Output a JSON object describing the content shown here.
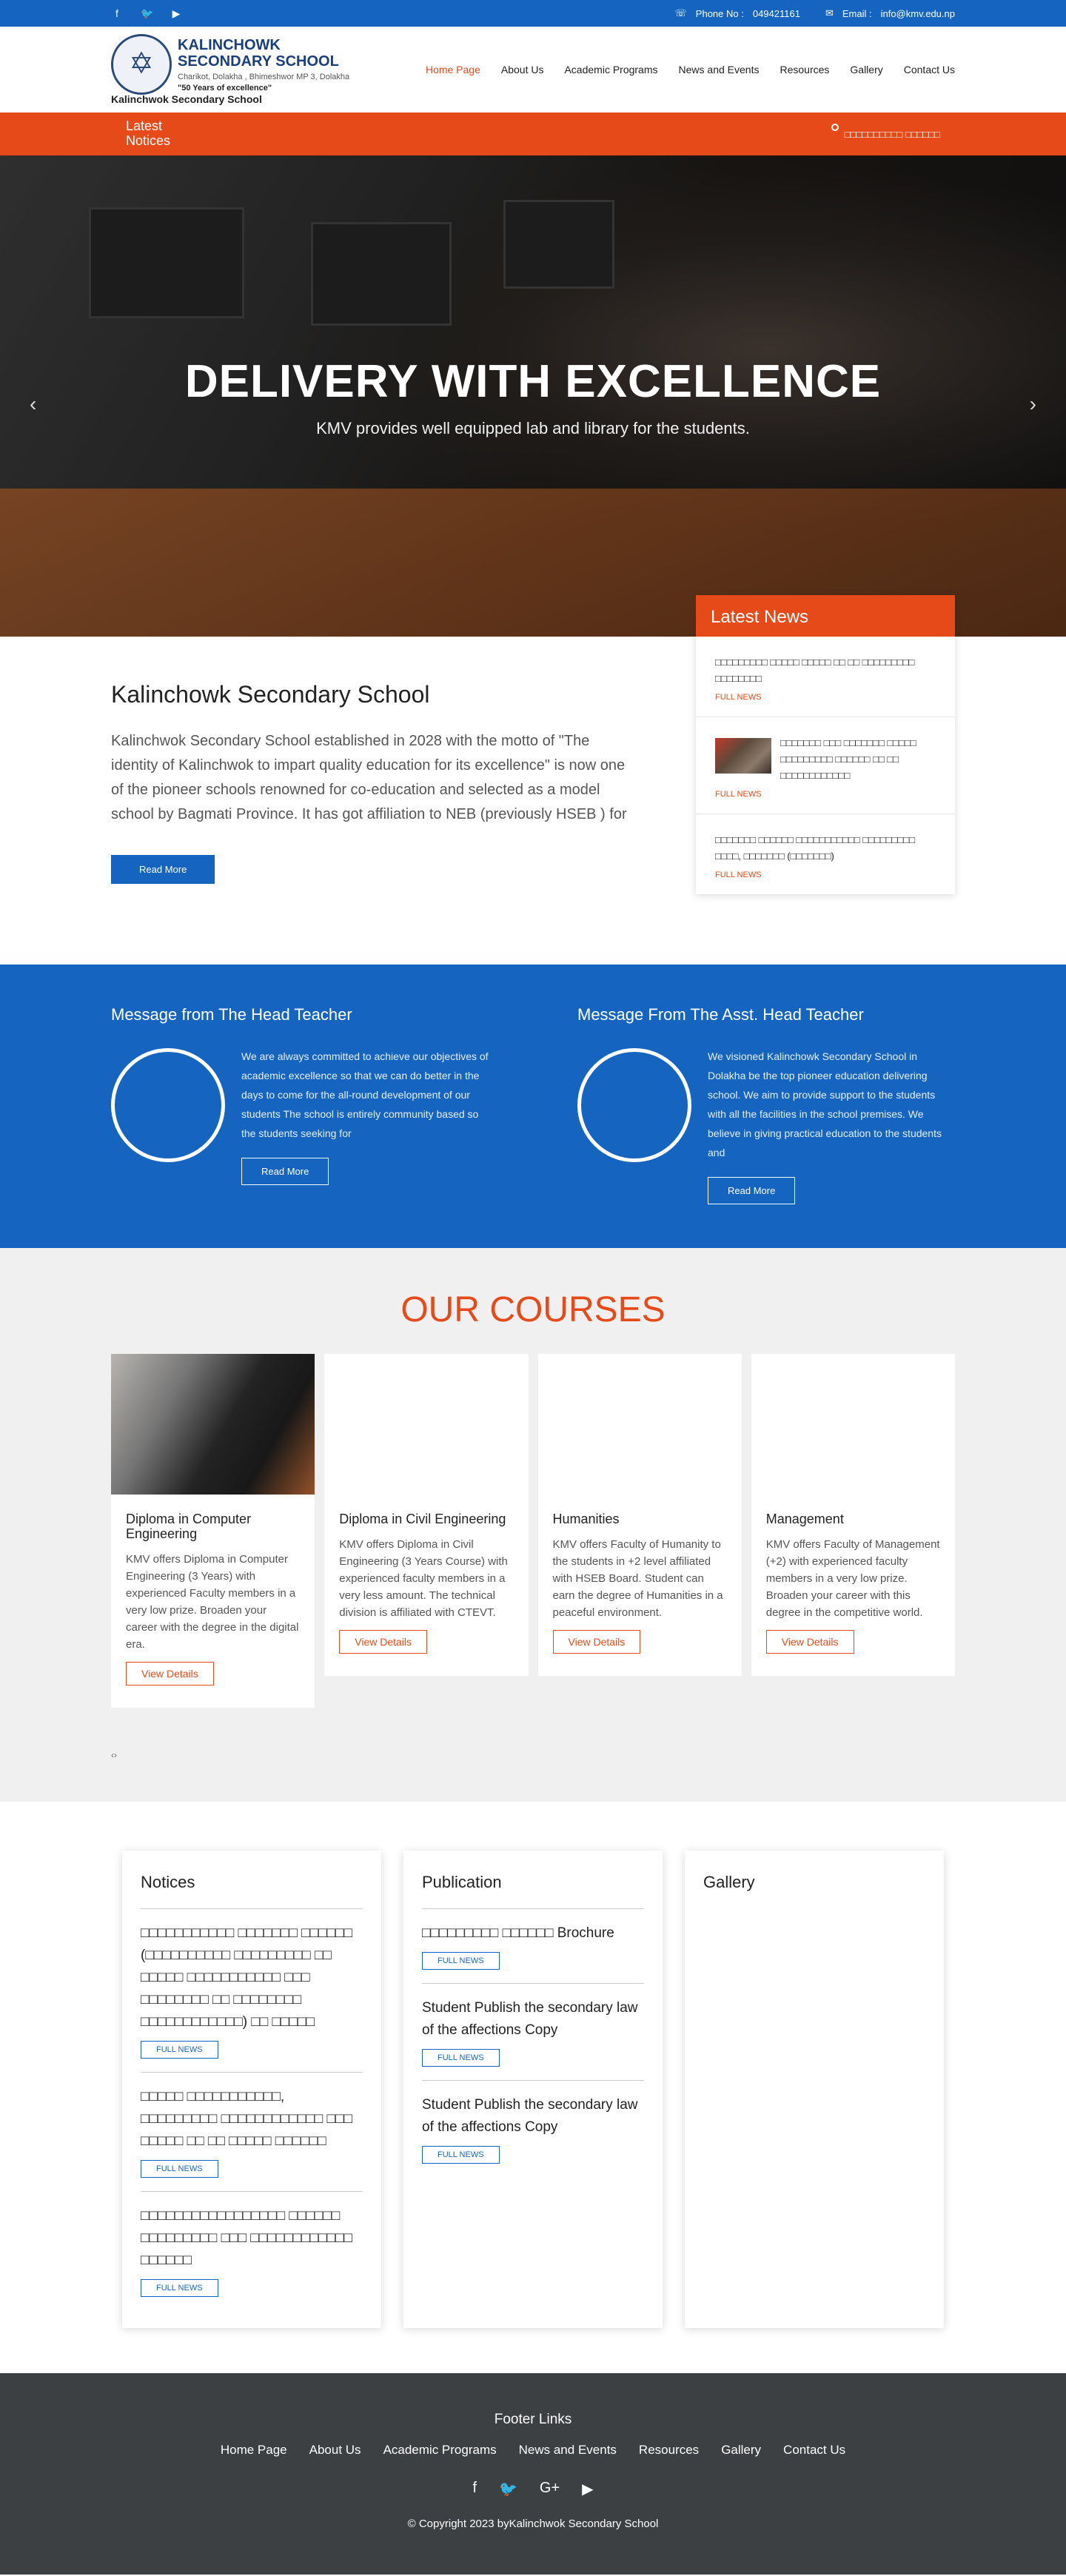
{
  "topbar": {
    "social": [
      {
        "icon": "facebook-icon",
        "glyph": "f"
      },
      {
        "icon": "twitter-icon",
        "glyph": "🐦"
      },
      {
        "icon": "youtube-icon",
        "glyph": "▶"
      }
    ],
    "phone_label": "Phone No :",
    "phone": "049421161",
    "email_label": "Email :",
    "email": "info@kmv.edu.np"
  },
  "brand": {
    "name": "KALINCHOWK SECONDARY SCHOOL",
    "address": "Charikot, Dolakha , Bhimeshwor MP 3, Dolakha",
    "motto": "\"50 Years of excellence\"",
    "subtitle": "Kalinchwok Secondary School"
  },
  "nav": [
    "Home Page",
    "About Us",
    "Academic Programs",
    "News and Events",
    "Resources",
    "Gallery",
    "Contact Us"
  ],
  "notice_strip": {
    "label": "Latest Notices",
    "ticker": "□□□□□□□□□□ □□□□□□"
  },
  "hero": {
    "title": "DELIVERY WITH EXCELLENCE",
    "subtitle": "KMV provides well equipped lab and library for the students.",
    "prev": "‹",
    "next": "›"
  },
  "intro": {
    "title": "Kalinchowk Secondary School",
    "body": "Kalinchwok Secondary School established in 2028 with the motto of \"The identity of Kalinchwok to impart quality education for its excellence\" is now one of the pioneer schools renowned for co-education and selected as a model school by Bagmati Province. It has got affiliation to NEB (previously HSEB ) for",
    "button": "Read More"
  },
  "latest_news": {
    "title": "Latest News",
    "full_news": "FULL NEWS",
    "items": [
      {
        "text": "□□□□□□□□□ □□□□□ □□□□□ □□ □□ □□□□□□□□□ □□□□□□□□"
      },
      {
        "text": "□□□□□□□ □□□ □□□□□□□ □□□□□ □□□□□□□□□ □□□□□□ □□ □□ □□□□□□□□□□□□"
      },
      {
        "text": "□□□□□□□ □□□□□□ □□□□□□□□□□□ □□□□□□□□□ □□□□, □□□□□□□ (□□□□□□□)"
      }
    ]
  },
  "messages": [
    {
      "title": "Message from The Head Teacher",
      "text": "We are always committed to achieve our objectives of academic excellence so that we can do better in the days to come  for the all-round development  of our students The school is entirely community based so the students  seeking for",
      "button": "Read More"
    },
    {
      "title": "Message From The Asst. Head Teacher",
      "text": "We visioned Kalinchowk Secondary School in Dolakha be the top pioneer education delivering school. We aim to provide support to the students with all the facilities in the school premises. We believe in giving practical education to the students and",
      "button": "Read More"
    }
  ],
  "courses": {
    "title": "OUR COURSES",
    "button": "View Details",
    "dots": "‹›",
    "items": [
      {
        "title": "Diploma in Computer Engineering",
        "desc": "KMV offers Diploma in Computer Engineering (3 Years) with experienced Faculty members in a very low prize. Broaden your career with the degree in the digital era."
      },
      {
        "title": "Diploma in Civil Engineering",
        "desc": "KMV offers Diploma in Civil Engineering (3 Years Course) with experienced faculty members in a very less amount. The technical division is affiliated with CTEVT."
      },
      {
        "title": "Humanities",
        "desc": "KMV offers Faculty of Humanity to the students in +2 level affiliated with HSEB Board. Student can earn the degree of Humanities in a peaceful environment."
      },
      {
        "title": "Management",
        "desc": "KMV offers Faculty of Management (+2) with experienced faculty members in a very low prize. Broaden your career with this degree in the competitive world."
      }
    ]
  },
  "notices": {
    "title": "Notices",
    "button": "FULL NEWS",
    "items": [
      {
        "text": "□□□□□□□□□□□ □□□□□□□ □□□□□□ (□□□□□□□□□□ □□□□□□□□□ □□ □□□□□ □□□□□□□□□□□ □□□ □□□□□□□□ □□ □□□□□□□□ □□□□□□□□□□□□) □□ □□□□□"
      },
      {
        "text": "□□□□□ □□□□□□□□□□□, □□□□□□□□□ □□□□□□□□□□□□ □□□ □□□□□ □□ □□ □□□□□ □□□□□□"
      },
      {
        "text": "□□□□□□□□□□□□□□□□□ □□□□□□ □□□□□□□□□ □□□ □□□□□□□□□□□□ □□□□□□"
      }
    ]
  },
  "publication": {
    "title": "Publication",
    "button": "FULL NEWS",
    "items": [
      {
        "text": "□□□□□□□□□ □□□□□□ Brochure"
      },
      {
        "text": "Student Publish the secondary law of the affections Copy"
      },
      {
        "text": "Student Publish the secondary law of the affections Copy"
      }
    ]
  },
  "gallery": {
    "title": "Gallery"
  },
  "footer": {
    "title": "Footer Links",
    "links": [
      "Home Page",
      "About Us",
      "Academic Programs",
      "News and Events",
      "Resources",
      "Gallery",
      "Contact Us"
    ],
    "social": [
      {
        "icon": "facebook-icon",
        "glyph": "f"
      },
      {
        "icon": "twitter-icon",
        "glyph": "🐦"
      },
      {
        "icon": "google-plus-icon",
        "glyph": "G+"
      },
      {
        "icon": "youtube-icon",
        "glyph": "▶"
      }
    ],
    "copyright": "© Copyright 2023 byKalinchwok Secondary School"
  },
  "colors": {
    "primary_blue": "#1565c0",
    "accent_orange": "#e64a19",
    "footer_bg": "#3c4043",
    "courses_bg": "#f0f0f0"
  }
}
